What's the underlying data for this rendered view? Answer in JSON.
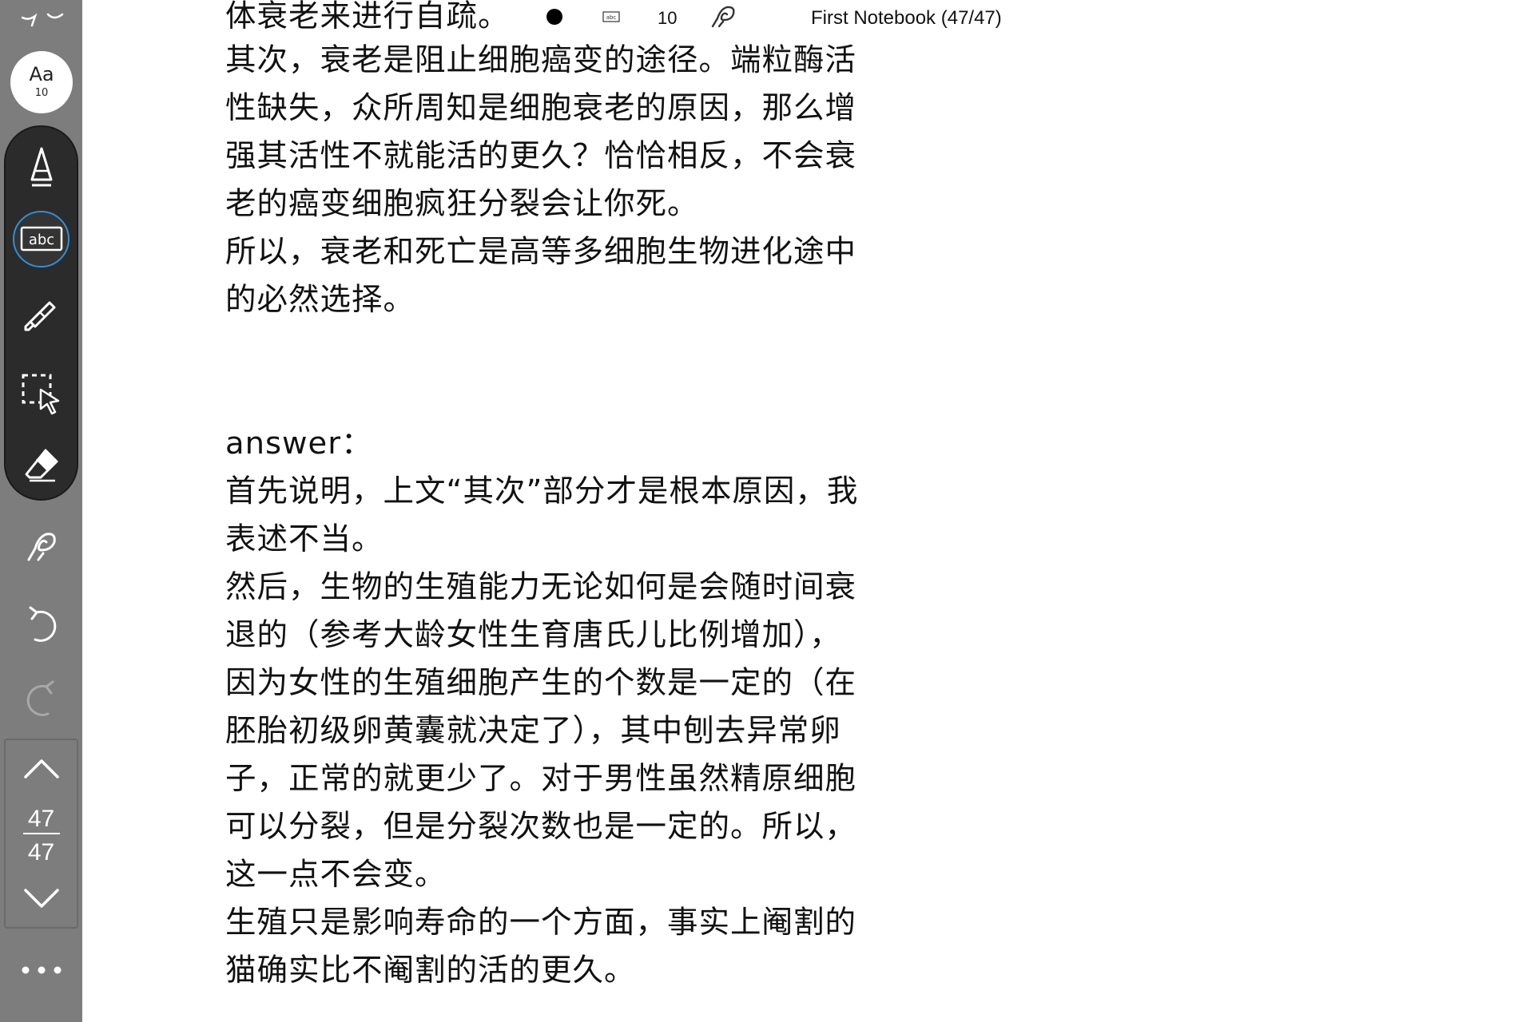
{
  "app": {
    "notebook_title": "First Notebook (47/47)",
    "accent_color": "#2f8fd8",
    "sidebar_color": "#7d7d7d",
    "toolbar_color": "#2b2b2b"
  },
  "status_bar": {
    "pen_color_icon": "filled-circle-icon",
    "text_mode_icon": "abc-box-icon",
    "size_value": "10",
    "lasso_icon": "hand-lasso-icon"
  },
  "sidebar": {
    "font_button": {
      "label": "Aa",
      "size": "10"
    },
    "tools": [
      {
        "name": "pen",
        "icon": "pen-tip-icon"
      },
      {
        "name": "text",
        "icon": "abc-text-icon",
        "label": "abc",
        "active": true
      },
      {
        "name": "highlighter",
        "icon": "highlighter-icon"
      },
      {
        "name": "select",
        "icon": "lasso-select-icon"
      },
      {
        "name": "eraser",
        "icon": "eraser-icon"
      }
    ],
    "gesture_icon": "hand-gesture-icon",
    "undo_icon": "undo-icon",
    "redo_icon": "redo-icon",
    "page_nav": {
      "current": "47",
      "total": "47"
    },
    "more_icon": "more-dots-icon"
  },
  "document": {
    "lines_top": [
      "体衰老来进行自疏。",
      "其次，衰老是阻止细胞癌变的途径。端粒酶活",
      "性缺失，众所周知是细胞衰老的原因，那么增",
      "强其活性不就能活的更久？恰恰相反，不会衰",
      "老的癌变细胞疯狂分裂会让你死。",
      "所以，衰老和死亡是高等多细胞生物进化途中",
      "的必然选择。"
    ],
    "lines_bottom": [
      "answer：",
      "首先说明，上文“其次”部分才是根本原因，我",
      "表述不当。",
      "然后，生物的生殖能力无论如何是会随时间衰",
      "退的（参考大龄女性生育唐氏儿比例增加），",
      "因为女性的生殖细胞产生的个数是一定的（在",
      "胚胎初级卵黄囊就决定了），其中刨去异常卵",
      "子，正常的就更少了。对于男性虽然精原细胞",
      "可以分裂，但是分裂次数也是一定的。所以，",
      "这一点不会变。",
      "生殖只是影响寿命的一个方面，事实上阉割的",
      "猫确实比不阉割的活的更久。"
    ]
  }
}
